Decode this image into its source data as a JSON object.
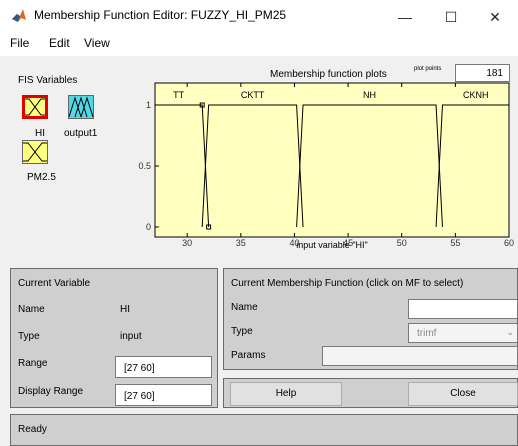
{
  "window": {
    "title": "Membership Function Editor: FUZZY_HI_PM25",
    "minimize_glyph": "—",
    "maximize_glyph": "☐",
    "close_glyph": "✕"
  },
  "menu": {
    "file": "File",
    "edit": "Edit",
    "view": "View"
  },
  "fis_variables": {
    "title": "FIS Variables",
    "items": [
      {
        "label": "HI",
        "icon": "input-variable-icon",
        "selected": true
      },
      {
        "label": "output1",
        "icon": "output-variable-icon",
        "selected": false
      },
      {
        "label": "PM2.5",
        "icon": "input-variable-icon",
        "selected": false
      }
    ]
  },
  "plot": {
    "title": "Membership function plots",
    "plot_points_label": "plot points",
    "plot_points_value": "181",
    "xlabel": "input variable \"HI\"",
    "xlim": [
      27,
      60
    ],
    "ylim": [
      0,
      1
    ],
    "x_ticks": [
      "30",
      "35",
      "40",
      "45",
      "50",
      "55",
      "60"
    ],
    "y_ticks": [
      "0",
      "0.5",
      "1"
    ],
    "mf_names": [
      "TT",
      "CKTT",
      "NH",
      "CKNH"
    ],
    "colors": {
      "background": "#ffffc0",
      "curve": "#000000",
      "selected_curve": "#ff0000"
    }
  },
  "chart_data": {
    "type": "line",
    "title": "Membership function plots",
    "xlabel": "input variable \"HI\"",
    "ylabel": "",
    "xlim": [
      27,
      60
    ],
    "ylim": [
      0,
      1
    ],
    "series": [
      {
        "name": "TT",
        "x": [
          27,
          31.4,
          32
        ],
        "y": [
          1,
          1,
          0
        ]
      },
      {
        "name": "CKTT",
        "x": [
          31.4,
          32,
          40.2,
          40.8
        ],
        "y": [
          0,
          1,
          1,
          0
        ]
      },
      {
        "name": "NH",
        "x": [
          40.2,
          40.8,
          53.2,
          53.8
        ],
        "y": [
          0,
          1,
          1,
          0
        ]
      },
      {
        "name": "CKNH",
        "x": [
          53.2,
          53.8,
          60
        ],
        "y": [
          0,
          1,
          1
        ]
      }
    ]
  },
  "current_variable": {
    "title": "Current Variable",
    "name_label": "Name",
    "name_value": "HI",
    "type_label": "Type",
    "type_value": "input",
    "range_label": "Range",
    "range_value": "[27 60]",
    "display_range_label": "Display Range",
    "display_range_value": "[27 60]"
  },
  "current_mf": {
    "title": "Current Membership Function (click on MF to select)",
    "name_label": "Name",
    "name_value": "",
    "type_label": "Type",
    "type_value": "trimf",
    "params_label": "Params",
    "params_value": ""
  },
  "buttons": {
    "help": "Help",
    "close": "Close"
  },
  "status": {
    "text": "Ready"
  }
}
